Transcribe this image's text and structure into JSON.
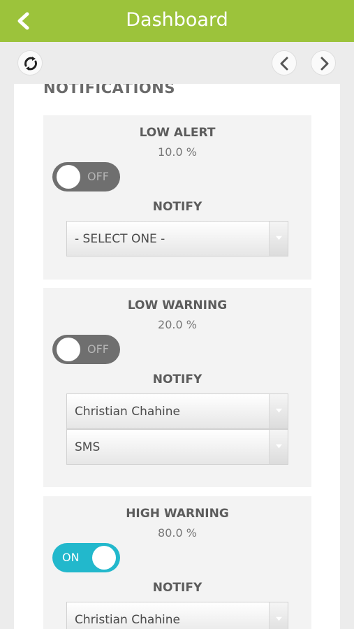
{
  "header": {
    "title": "Dashboard"
  },
  "section": {
    "title": "NOTIFICATIONS"
  },
  "cards": [
    {
      "title": "LOW ALERT",
      "value": "10.0 %",
      "toggle": "OFF",
      "notify_label": "NOTIFY",
      "selects": [
        "- SELECT ONE -"
      ]
    },
    {
      "title": "LOW WARNING",
      "value": "20.0 %",
      "toggle": "OFF",
      "notify_label": "NOTIFY",
      "selects": [
        "Christian Chahine",
        "SMS"
      ]
    },
    {
      "title": "HIGH WARNING",
      "value": "80.0 %",
      "toggle": "ON",
      "notify_label": "NOTIFY",
      "selects": [
        "Christian Chahine"
      ]
    }
  ],
  "icons": {
    "back": "chevron-left-icon",
    "refresh": "refresh-icon",
    "prev": "chevron-left-icon",
    "next": "chevron-right-icon",
    "dropdown": "caret-down-icon"
  },
  "colors": {
    "header": "#9cc33b",
    "toggle_off": "#6f6f6f",
    "toggle_on": "#22b8cc"
  }
}
